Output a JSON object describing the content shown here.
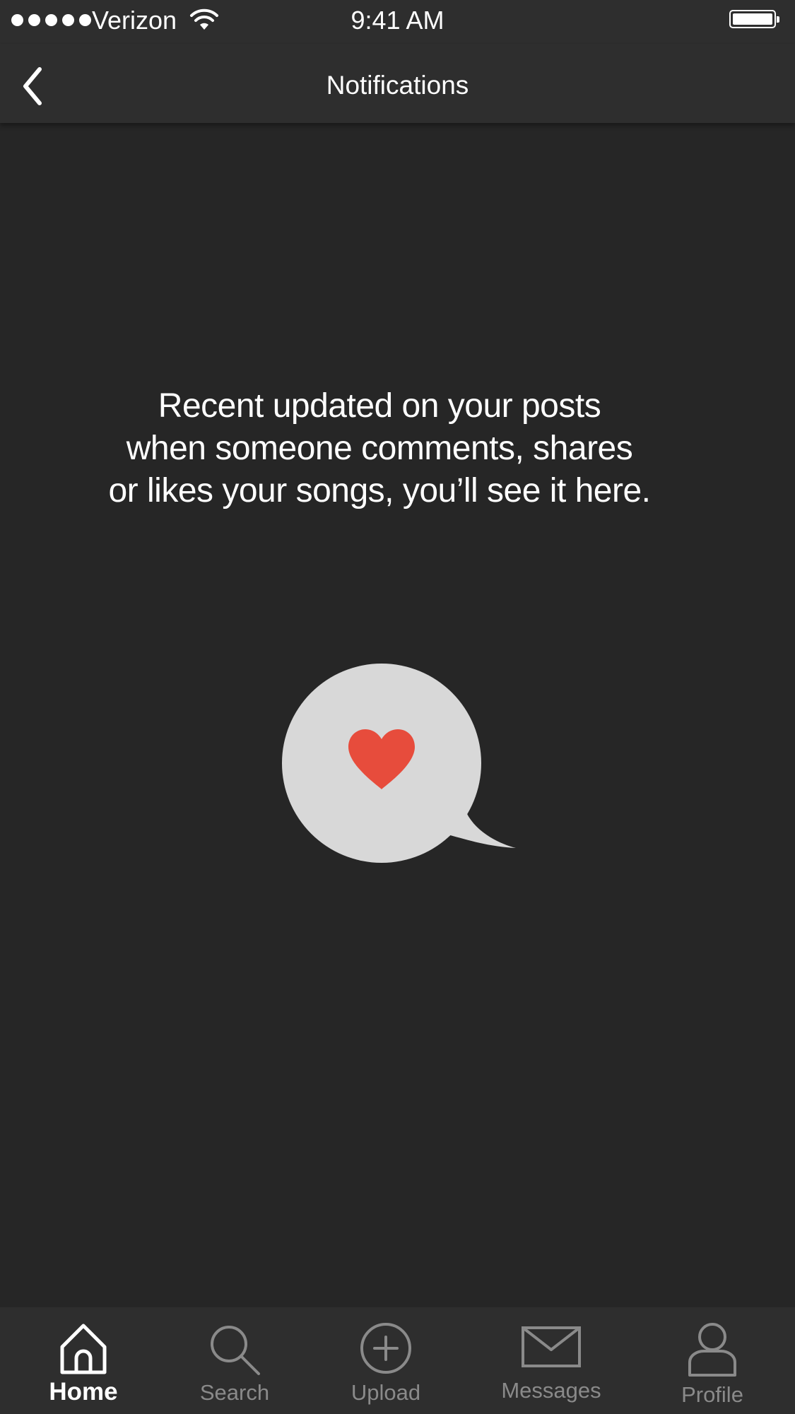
{
  "status_bar": {
    "carrier": "Verizon",
    "time": "9:41 AM",
    "signal_bars": 5
  },
  "nav": {
    "title": "Notifications",
    "back_icon": "chevron-left-icon"
  },
  "empty_state": {
    "message_lines": [
      "Recent updated on your posts",
      "when someone comments, shares",
      "or likes your songs, you’ll see it here."
    ],
    "illustration_icon": "heart-speech-bubble-icon",
    "bubble_color": "#d8d8d8",
    "heart_color": "#e74c3c"
  },
  "tabs": [
    {
      "label": "Home",
      "icon": "home-icon",
      "active": true
    },
    {
      "label": "Search",
      "icon": "search-icon",
      "active": false
    },
    {
      "label": "Upload",
      "icon": "upload-plus-icon",
      "active": false
    },
    {
      "label": "Messages",
      "icon": "envelope-icon",
      "active": false
    },
    {
      "label": "Profile",
      "icon": "profile-icon",
      "active": false
    }
  ],
  "colors": {
    "background": "#262626",
    "bars": "#2e2e2e",
    "inactive_tab": "#8a8a8a",
    "active_tab": "#ffffff"
  }
}
